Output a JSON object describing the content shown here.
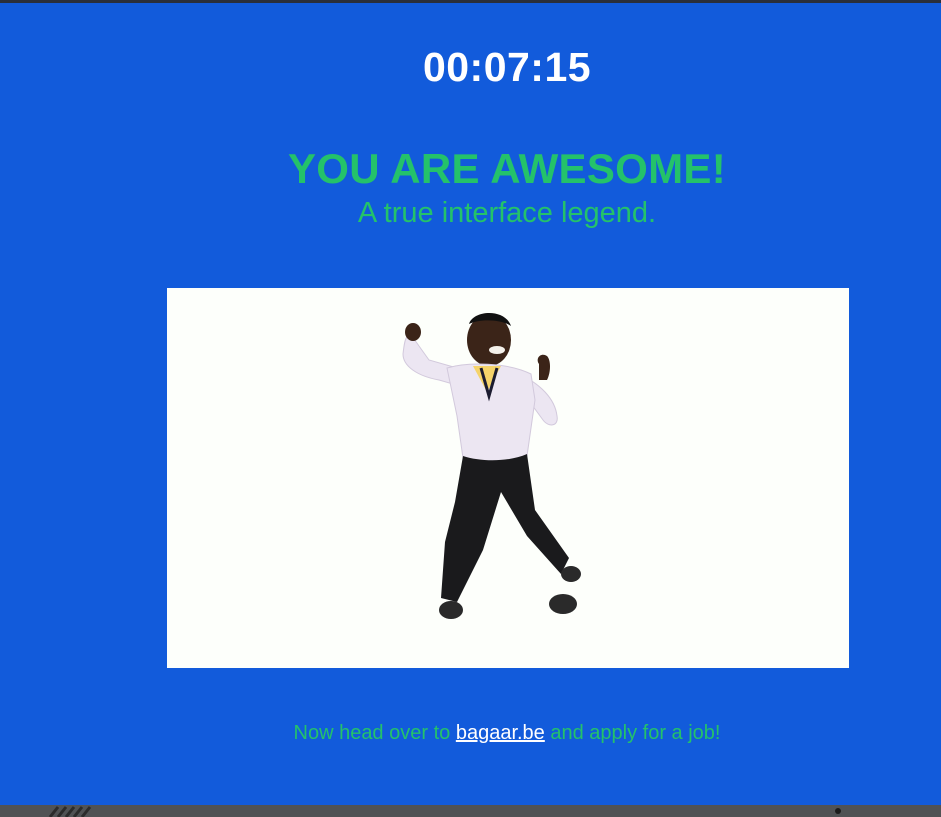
{
  "timer": {
    "value": "00:07:15"
  },
  "message": {
    "headline": "YOU ARE AWESOME!",
    "subline": "A true interface legend."
  },
  "media": {
    "description_icon": "dancing-person-image"
  },
  "footer": {
    "prefix": "Now head over to ",
    "link_text": "bagaar.be",
    "suffix": " and apply for a job!"
  },
  "colors": {
    "background": "#125bdb",
    "accent_green": "#24c26a",
    "text_white": "#ffffff",
    "media_bg": "#fdfffb"
  }
}
